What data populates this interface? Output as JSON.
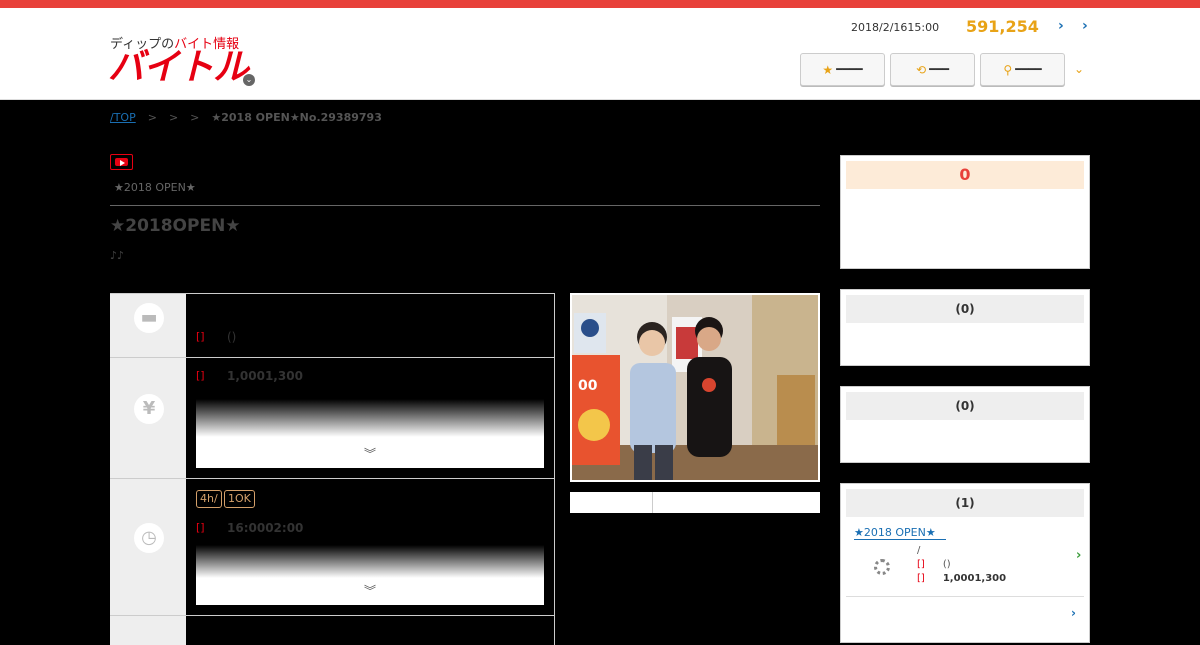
{
  "header": {
    "logo_sub_plain": "ディップの",
    "logo_sub_red": "バイト情報",
    "logo_main": "バイトル",
    "timestamp": "2018/2/1615:00",
    "count": "591,254",
    "buttons": [
      {
        "icon": "star-icon",
        "label": ""
      },
      {
        "icon": "history-icon",
        "label": ""
      },
      {
        "icon": "search-icon",
        "label": ""
      }
    ]
  },
  "breadcrumb": {
    "top": "/TOP",
    "sep1": ">",
    "sep2": ">",
    "sep3": ">",
    "current": "★2018 OPEN★No.29389793"
  },
  "job": {
    "subtitle": "★2018 OPEN★",
    "title": "★2018OPEN★",
    "notes": "♪♪"
  },
  "rows": [
    {
      "icon": "briefcase-icon",
      "tag": "[]",
      "value": "()"
    },
    {
      "icon": "yen-icon",
      "tag": "[]",
      "value": "1,0001,300"
    },
    {
      "icon": "clock-icon",
      "tag": "[]",
      "value": "16:0002:00",
      "badges": [
        "4h/",
        "1OK"
      ]
    },
    {
      "icon": "map-icon"
    }
  ],
  "sidebar": {
    "box1_count": "0",
    "box2_head": "(0)",
    "box3_head": "(0)",
    "box4_head": "(1)",
    "box4_link": "★2018 OPEN★",
    "box4_line1": "/",
    "box4_line2_tag": "[]",
    "box4_line2_val": "()",
    "box4_line3_tag": "[]",
    "box4_line3_val": "1,0001,300"
  }
}
